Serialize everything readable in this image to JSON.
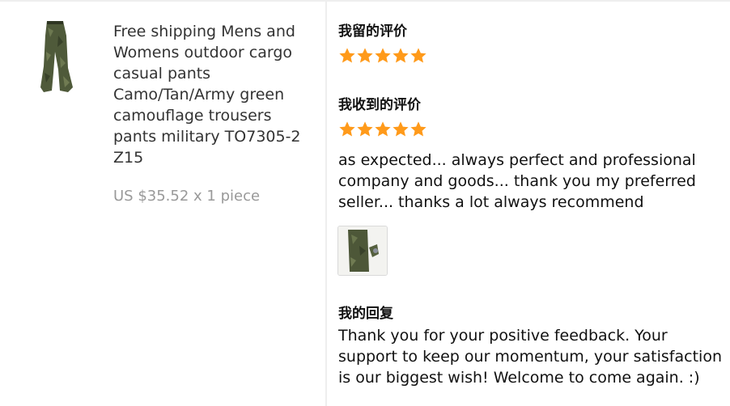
{
  "product": {
    "title": "Free shipping Mens and\nWomens outdoor cargo\ncasual pants\nCamo/Tan/Army green\ncamouflage trousers\npants military TO7305-2\nZ15",
    "price": "US $35.52 x 1 piece",
    "image_icon": "camo-pants-image"
  },
  "my_review": {
    "heading": "我留的评价",
    "rating": 5
  },
  "received_review": {
    "heading": "我收到的评价",
    "rating": 5,
    "text": "as expected... always perfect and professional\ncompany and goods... thank you my preferred\nseller... thanks a lot always recommend",
    "photo_icon": "review-photo"
  },
  "my_reply": {
    "heading": "我的回复",
    "text": "Thank you for your positive feedback. Your\nsupport to keep our momentum, your satisfaction\nis our biggest wish! Welcome to come again. :)"
  },
  "colors": {
    "star": "#ff9a1a",
    "price": "#999999",
    "divider": "#eeeeee"
  }
}
